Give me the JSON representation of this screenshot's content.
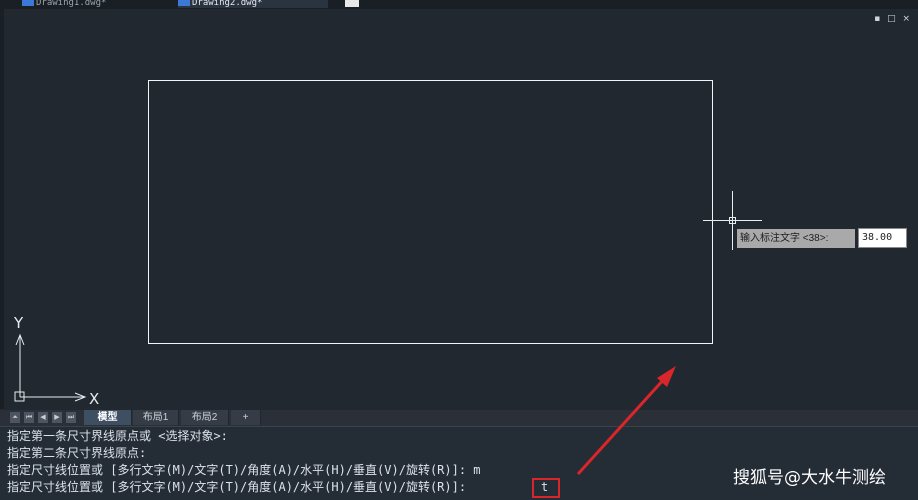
{
  "doc_tabs": [
    {
      "label": "Drawing1.dwg*",
      "active": false
    },
    {
      "label": "Drawing2.dwg*",
      "active": true
    }
  ],
  "viewport": {
    "controls": "▪ □ ×"
  },
  "dynamic_input": {
    "prompt": "输入标注文字 <38>:",
    "value": "38.00"
  },
  "ucs": {
    "x_label": "X",
    "y_label": "Y"
  },
  "layout_nav": [
    "⏶",
    "⏮",
    "◀",
    "▶",
    "⏭"
  ],
  "layout_tabs": [
    {
      "label": "模型",
      "active": true
    },
    {
      "label": "布局1",
      "active": false
    },
    {
      "label": "布局2",
      "active": false
    },
    {
      "label": "+",
      "active": false
    }
  ],
  "command": {
    "lines": [
      "指定第一条尺寸界线原点或 <选择对象>:",
      "指定第二条尺寸界线原点:",
      "指定尺寸线位置或 [多行文字(M)/文字(T)/角度(A)/水平(H)/垂直(V)/旋转(R)]: m",
      "指定尺寸线位置或 [多行文字(M)/文字(T)/角度(A)/水平(H)/垂直(V)/旋转(R)]:"
    ],
    "input": "t"
  },
  "colors": {
    "background": "#212830",
    "highlight": "#d9262a"
  },
  "watermark": "搜狐号@大水牛测绘"
}
